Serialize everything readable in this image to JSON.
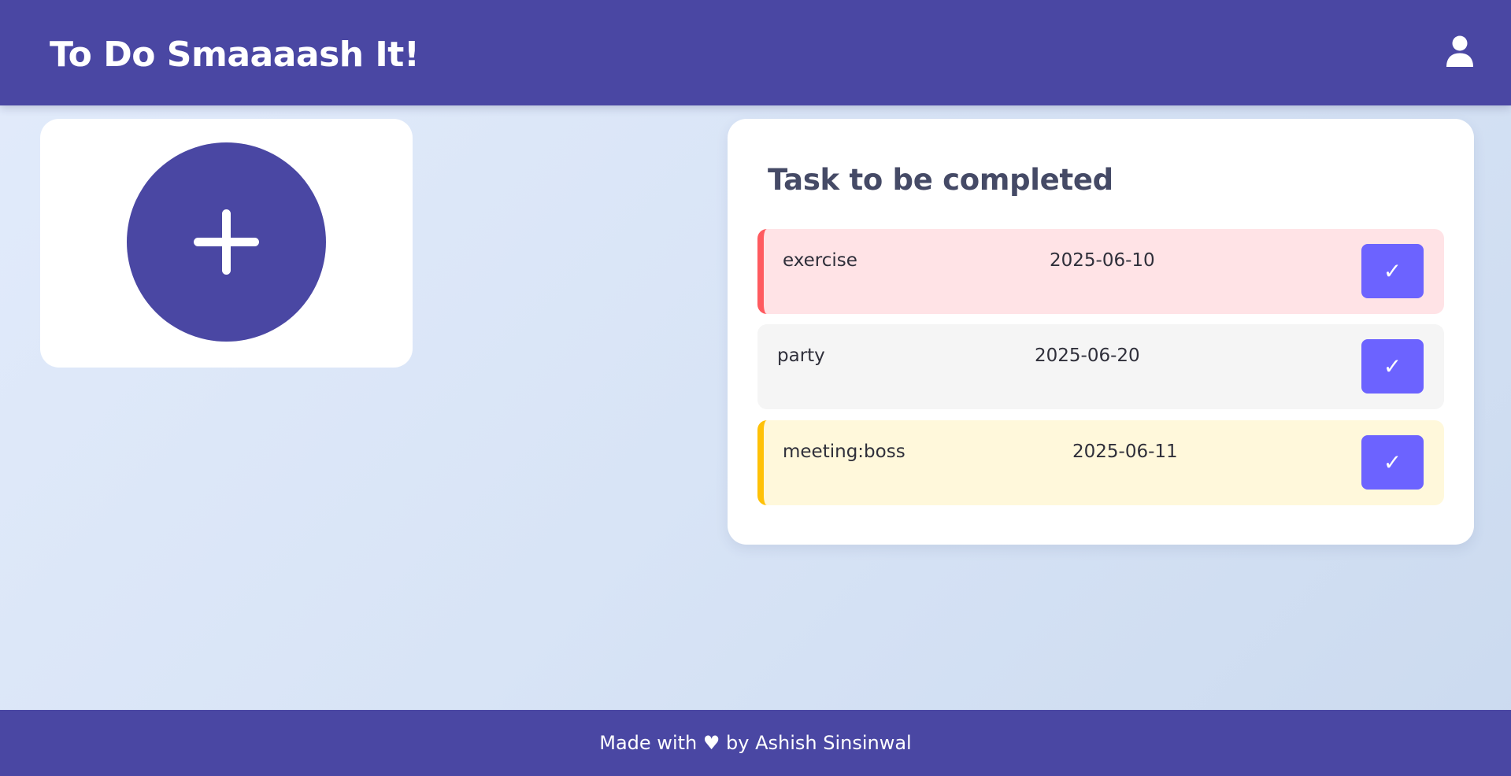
{
  "header": {
    "title": "To Do Smaaaash It!",
    "user_icon": "user-icon"
  },
  "add_card": {
    "icon": "plus-icon"
  },
  "task_panel": {
    "title": "Task to be completed",
    "tasks": [
      {
        "name": "exercise",
        "date": "2025-06-10",
        "complete_label": "✓"
      },
      {
        "name": "party",
        "date": "2025-06-20",
        "complete_label": "✓"
      },
      {
        "name": "meeting:boss",
        "date": "2025-06-11",
        "complete_label": "✓"
      }
    ]
  },
  "footer": {
    "text": "Made with ♥ by Ashish Sinsinwal"
  },
  "colors": {
    "brand": "#4a47a3",
    "button": "#6c63ff",
    "priority_high": "#ff5a5f",
    "priority_medium": "#ffc107"
  }
}
